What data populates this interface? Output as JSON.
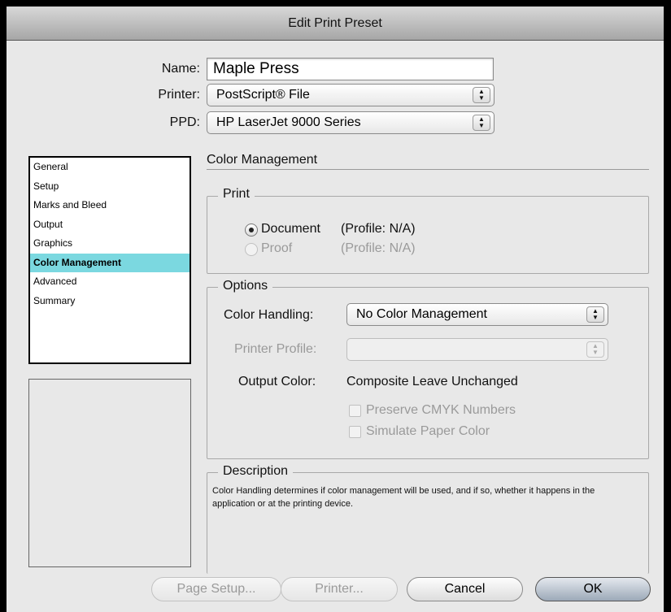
{
  "window": {
    "title": "Edit Print Preset"
  },
  "form": {
    "name_label": "Name:",
    "name_value": "Maple Press",
    "printer_label": "Printer:",
    "printer_value": "PostScript® File",
    "ppd_label": "PPD:",
    "ppd_value": "HP LaserJet 9000 Series"
  },
  "sidebar": {
    "items": [
      {
        "label": "General"
      },
      {
        "label": "Setup"
      },
      {
        "label": "Marks and Bleed"
      },
      {
        "label": "Output"
      },
      {
        "label": "Graphics"
      },
      {
        "label": "Color Management"
      },
      {
        "label": "Advanced"
      },
      {
        "label": "Summary"
      }
    ],
    "selected": "Color Management"
  },
  "panel": {
    "title": "Color Management",
    "print_group": {
      "legend": "Print",
      "document_label": "Document",
      "document_profile": "(Profile: N/A)",
      "proof_label": "Proof",
      "proof_profile": "(Profile: N/A)",
      "selected": "Document"
    },
    "options_group": {
      "legend": "Options",
      "color_handling_label": "Color Handling:",
      "color_handling_value": "No Color Management",
      "printer_profile_label": "Printer Profile:",
      "printer_profile_value": "",
      "output_color_label": "Output Color:",
      "output_color_value": "Composite Leave Unchanged",
      "preserve_cmyk_label": "Preserve CMYK Numbers",
      "simulate_paper_label": "Simulate Paper Color"
    },
    "description_group": {
      "legend": "Description",
      "text": "Color Handling determines if color management will be used, and if so, whether it happens in the application or at the printing device."
    }
  },
  "buttons": {
    "page_setup": "Page Setup...",
    "printer": "Printer...",
    "cancel": "Cancel",
    "ok": "OK"
  },
  "colors": {
    "selection": "#7bd8e0",
    "window_bg": "#e8e8e8"
  }
}
